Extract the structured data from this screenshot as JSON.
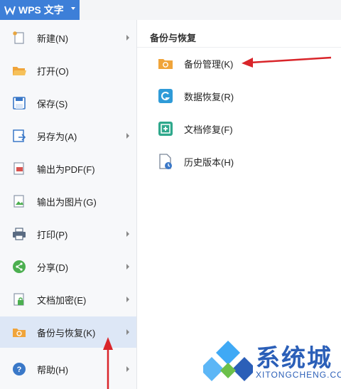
{
  "app": {
    "title": "WPS 文字"
  },
  "menu": {
    "items": [
      {
        "label": "新建(N)",
        "icon": "new-document-icon",
        "submenu": true
      },
      {
        "label": "打开(O)",
        "icon": "folder-open-icon",
        "submenu": false
      },
      {
        "label": "保存(S)",
        "icon": "save-icon",
        "submenu": false
      },
      {
        "label": "另存为(A)",
        "icon": "save-as-icon",
        "submenu": true
      },
      {
        "label": "输出为PDF(F)",
        "icon": "pdf-export-icon",
        "submenu": false
      },
      {
        "label": "输出为图片(G)",
        "icon": "image-export-icon",
        "submenu": false
      },
      {
        "label": "打印(P)",
        "icon": "printer-icon",
        "submenu": true
      },
      {
        "label": "分享(D)",
        "icon": "share-icon",
        "submenu": true
      },
      {
        "label": "文档加密(E)",
        "icon": "lock-document-icon",
        "submenu": true
      },
      {
        "label": "备份与恢复(K)",
        "icon": "backup-folder-icon",
        "submenu": true,
        "active": true
      },
      {
        "label": "帮助(H)",
        "icon": "help-icon",
        "submenu": true
      }
    ]
  },
  "panel": {
    "title": "备份与恢复",
    "items": [
      {
        "label": "备份管理(K)",
        "icon": "backup-manage-icon"
      },
      {
        "label": "数据恢复(R)",
        "icon": "data-recovery-icon"
      },
      {
        "label": "文档修复(F)",
        "icon": "document-repair-icon"
      },
      {
        "label": "历史版本(H)",
        "icon": "history-version-icon"
      }
    ]
  },
  "watermark": {
    "title": "系统城",
    "subtitle": "XITONGCHENG.COM"
  },
  "colors": {
    "accent": "#3d7fd8",
    "annotation": "#d9252a",
    "active_bg": "#dde7f6"
  }
}
